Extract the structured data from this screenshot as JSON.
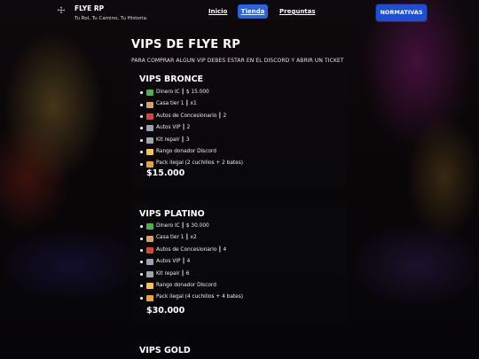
{
  "header": {
    "brand_name": "FLYE RP",
    "tagline": "Tu Rol, Tu Camino, Tu Historia.",
    "nav": [
      "Inicio",
      "Tienda",
      "Preguntas"
    ],
    "cta": "NORMATIVAS"
  },
  "main": {
    "title": "VIPS DE FLYE RP",
    "subtitle": "PARA COMPRAR ALGUN VIP DEBES ESTAR EN EL DISCORD Y ABRIR UN TICKET"
  },
  "vips": [
    {
      "title": "VIPS BRONCE",
      "price": "$15.000",
      "features": [
        {
          "icon": "money-icon",
          "text": "Dinero IC ┃ $ 15.000"
        },
        {
          "icon": "house-icon",
          "text": "Casa tier 1 ┃ x1"
        },
        {
          "icon": "car-icon",
          "text": "Autos de Concesionario ┃ 2"
        },
        {
          "icon": "rocket-icon",
          "text": "Autos VIP ┃ 2"
        },
        {
          "icon": "wrench-icon",
          "text": "Kit repair ┃ 3"
        },
        {
          "icon": "crown-icon",
          "text": "Rango donador Discord"
        },
        {
          "icon": "pistol-icon",
          "text": "Pack ilegal (2 cuchillos + 2 bates)"
        }
      ]
    },
    {
      "title": "VIPS PLATINO",
      "price": "$30.000",
      "features": [
        {
          "icon": "money-icon",
          "text": "Dinero IC ┃ $ 30.000"
        },
        {
          "icon": "house-icon",
          "text": "Casa tier 1 ┃ x2"
        },
        {
          "icon": "car-icon",
          "text": "Autos de Concesionario ┃ 4"
        },
        {
          "icon": "rocket-icon",
          "text": "Autos VIP ┃ 4"
        },
        {
          "icon": "wrench-icon",
          "text": "Kit repair ┃ 6"
        },
        {
          "icon": "crown-icon",
          "text": "Rango donador Discord"
        },
        {
          "icon": "pistol-icon",
          "text": "Pack ilegal (4 cuchillos + 4 bates)"
        }
      ]
    },
    {
      "title": "VIPS GOLD"
    }
  ],
  "colors": {
    "accent": "#2563eb",
    "cta": "#1d4ed8",
    "icon_money": "#4caf50",
    "icon_house": "#d9a066",
    "icon_car": "#d9443a",
    "icon_rocket": "#9aa0b5",
    "icon_wrench": "#a0a4ab",
    "icon_crown": "#f5c542",
    "icon_pistol": "#e8a33c"
  }
}
